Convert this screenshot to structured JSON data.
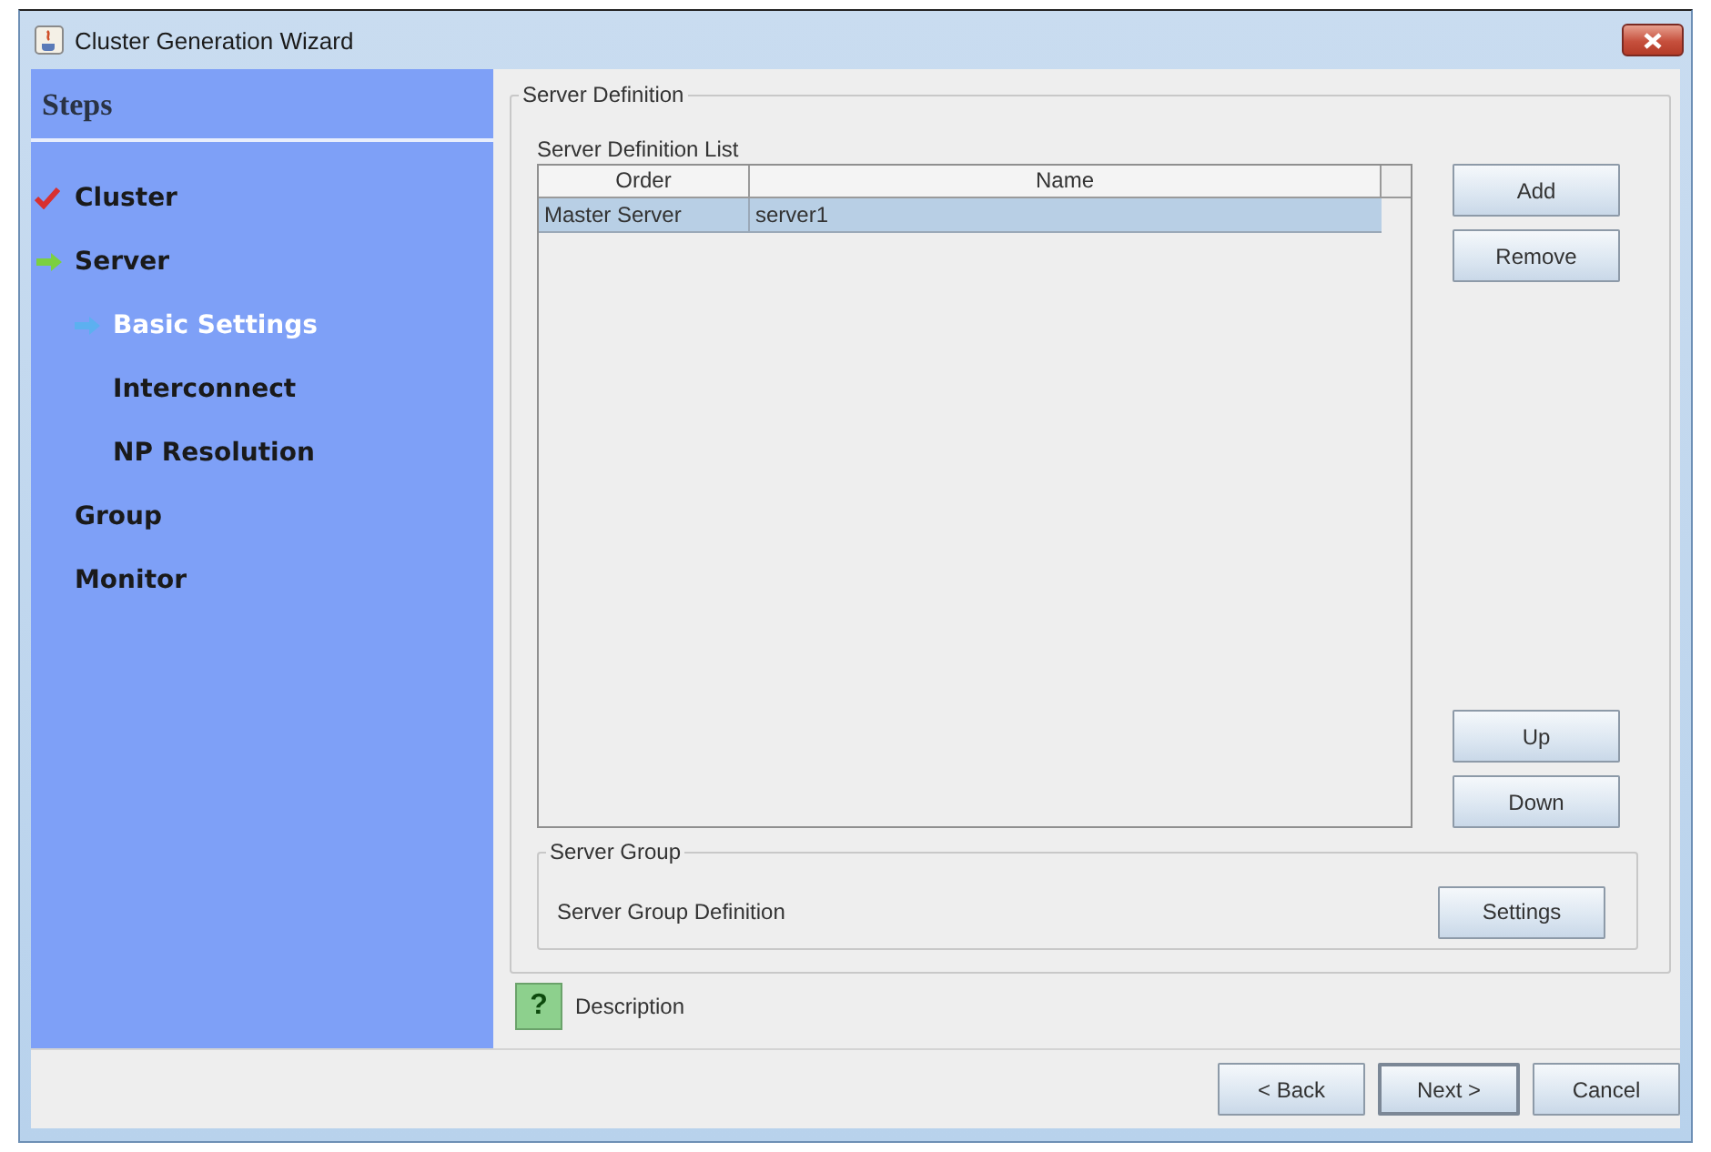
{
  "window": {
    "title": "Cluster Generation Wizard"
  },
  "steps": {
    "title": "Steps",
    "items": [
      {
        "label": "Cluster",
        "kind": "done"
      },
      {
        "label": "Server",
        "kind": "current",
        "children": [
          {
            "label": "Basic Settings",
            "kind": "active"
          },
          {
            "label": "Interconnect",
            "kind": "pending"
          },
          {
            "label": "NP Resolution",
            "kind": "pending"
          }
        ]
      },
      {
        "label": "Group",
        "kind": "pending"
      },
      {
        "label": "Monitor",
        "kind": "pending"
      }
    ]
  },
  "server_definition": {
    "title": "Server Definition",
    "list_label": "Server Definition List",
    "table": {
      "columns": [
        "Order",
        "Name"
      ],
      "rows": [
        {
          "cells": [
            "Master Server",
            "server1"
          ],
          "selected": true
        }
      ]
    },
    "buttons": [
      "Add",
      "Remove",
      "Up",
      "Down"
    ]
  },
  "server_group": {
    "title": "Server Group",
    "label": "Server Group Definition",
    "button": "Settings"
  },
  "description": {
    "label": "Description",
    "icon": "?"
  },
  "footer_buttons": [
    {
      "label": "< Back",
      "focused": false
    },
    {
      "label": "Next >",
      "focused": true
    },
    {
      "label": "Cancel",
      "focused": false
    }
  ]
}
